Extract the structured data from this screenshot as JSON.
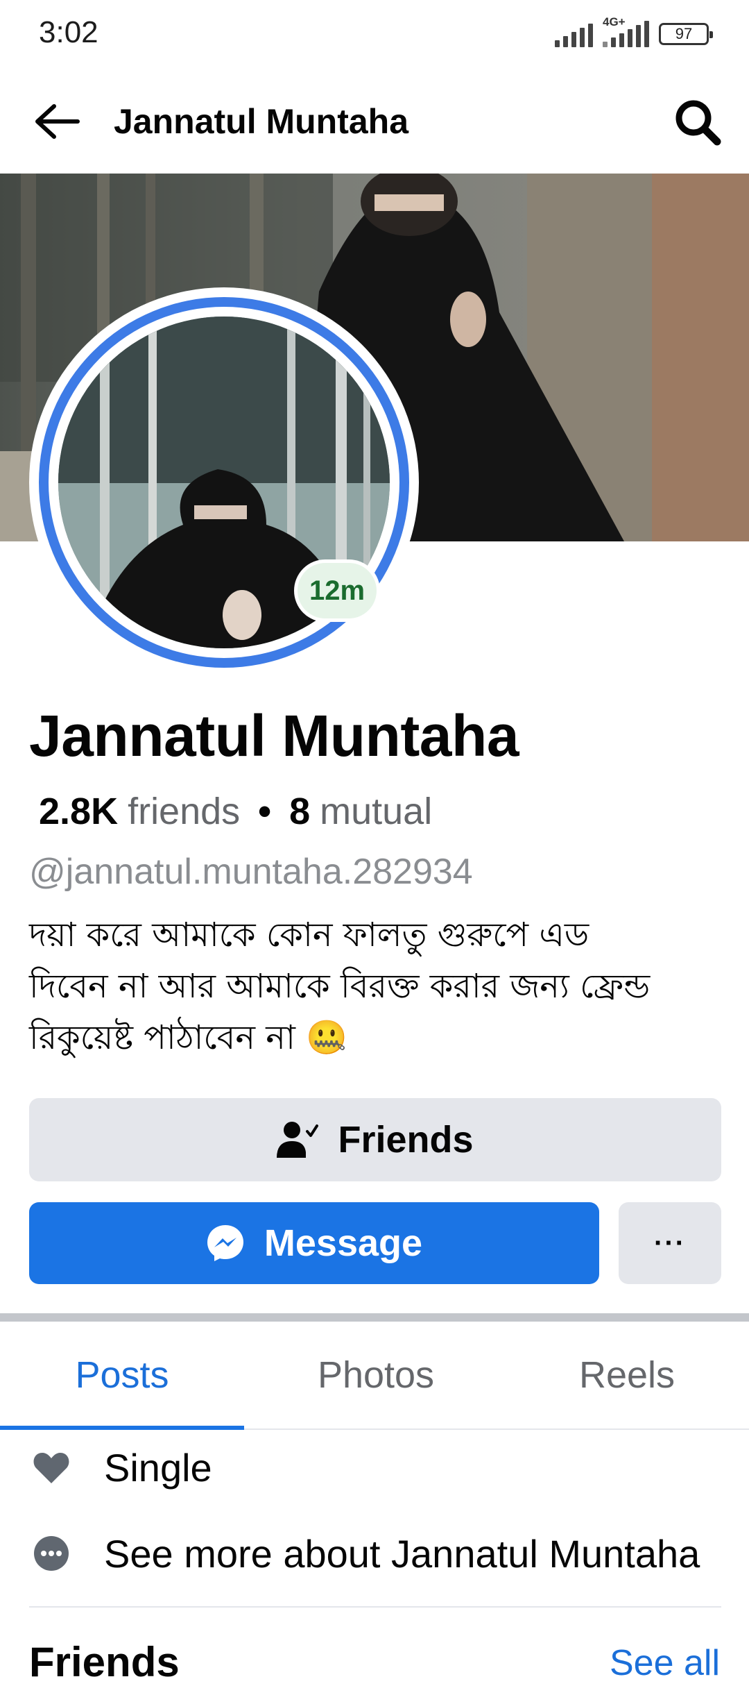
{
  "status_bar": {
    "time": "3:02",
    "network_label": "4G+",
    "battery_level": "97",
    "signal_bars": 4
  },
  "header": {
    "title": "Jannatul Muntaha",
    "back_icon": "arrow-left-icon",
    "search_icon": "search-icon"
  },
  "profile": {
    "name": "Jannatul Muntaha",
    "story_badge": "12m",
    "friends_count": "2.8K",
    "friends_label": "friends",
    "separator": "•",
    "mutual_count": "8",
    "mutual_label": "mutual",
    "username": "@jannatul.muntaha.282934",
    "bio_lines": [
      "দয়া করে আমাকে কোন ফালতু গুরুপে এড",
      "দিবেন না আর আমাকে বিরক্ত করার জন্য ফ্রেন্ড",
      "রিকুয়েষ্ট পাঠাবেন না 🤐"
    ]
  },
  "actions": {
    "friends_label": "Friends",
    "message_label": "Message",
    "more_label": "···"
  },
  "tabs": [
    {
      "label": "Posts",
      "active": true
    },
    {
      "label": "Photos",
      "active": false
    },
    {
      "label": "Reels",
      "active": false
    }
  ],
  "about": {
    "relationship": "Single",
    "see_more": "See more about Jannatul Muntaha"
  },
  "friends_section": {
    "heading": "Friends",
    "see_all": "See all"
  },
  "colors": {
    "accent": "#1b74e4",
    "button_grey": "#e4e6eb",
    "story_ring": "#3d7be6",
    "badge_bg": "#e6f4e8",
    "badge_text": "#1a6b2e"
  }
}
